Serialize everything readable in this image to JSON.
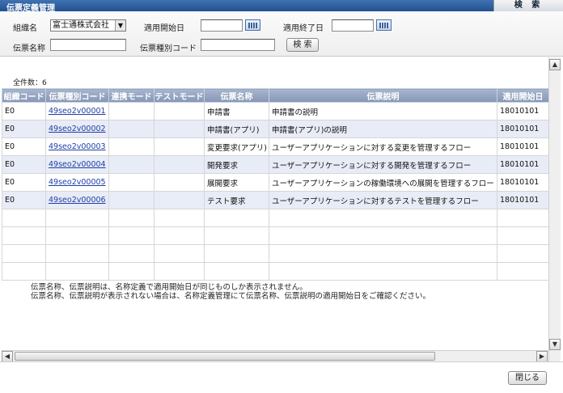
{
  "titlebar": {
    "title": "伝票定義管理",
    "search_tab": "検 索"
  },
  "form": {
    "org_label": "組織名",
    "org_value": "富士通株式会社",
    "start_label": "適用開始日",
    "start_value": "",
    "end_label": "適用終了日",
    "end_value": "",
    "name_label": "伝票名称",
    "name_value": "",
    "code_label": "伝票種別コード",
    "code_value": "",
    "search_button": "検 索"
  },
  "result": {
    "count": "全件数：6",
    "columns": [
      "組織コード",
      "伝票種別コード",
      "連携モード",
      "テストモード",
      "伝票名称",
      "伝票説明",
      "適用開始日"
    ],
    "rows": [
      [
        "E0",
        "49seo2v00001",
        "",
        "",
        "申請書",
        "申請書の説明",
        "18010101"
      ],
      [
        "E0",
        "49seo2v00002",
        "",
        "",
        "申請書(アプリ)",
        "申請書(アプリ)の説明",
        "18010101"
      ],
      [
        "E0",
        "49seo2v00003",
        "",
        "",
        "変更要求(アプリ)",
        "ユーザーアプリケーションに対する変更を管理するフロー",
        "18010101"
      ],
      [
        "E0",
        "49seo2v00004",
        "",
        "",
        "開発要求",
        "ユーザーアプリケーションに対する開発を管理するフロー",
        "18010101"
      ],
      [
        "E0",
        "49seo2v00005",
        "",
        "",
        "展開要求",
        "ユーザーアプリケーションの稼働環境への展開を管理するフロー",
        "18010101"
      ],
      [
        "E0",
        "49seo2v00006",
        "",
        "",
        "テスト要求",
        "ユーザーアプリケーションに対するテストを管理するフロー",
        "18010101"
      ]
    ],
    "notes": [
      "伝票名称、伝票説明は、名称定義で適用開始日が同じものしか表示されません。",
      "伝票名称、伝票説明が表示されない場合は、名称定義管理にて伝票名称、伝票説明の適用開始日をご確認ください。"
    ]
  },
  "footer": {
    "close_button": "閉じる"
  }
}
